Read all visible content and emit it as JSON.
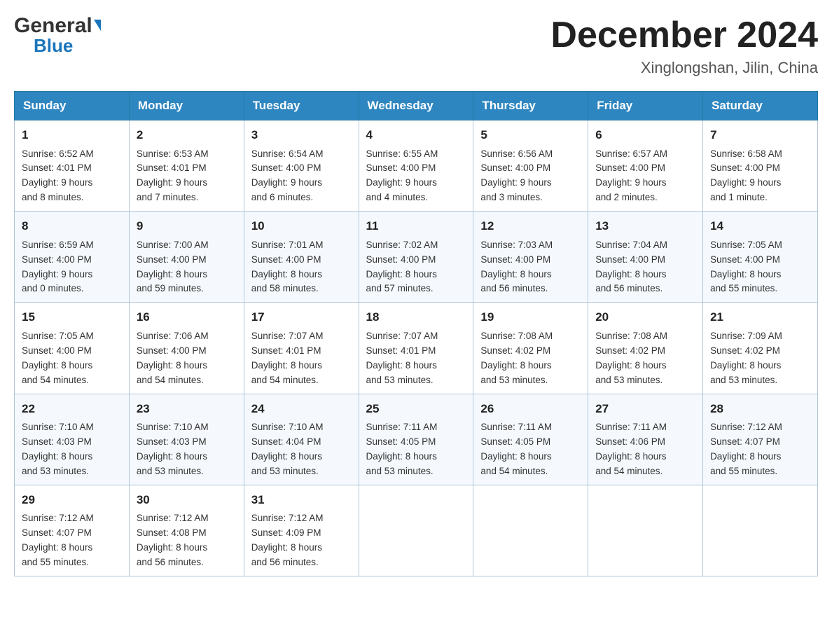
{
  "logo": {
    "general": "General",
    "blue": "Blue"
  },
  "title": "December 2024",
  "location": "Xinglongshan, Jilin, China",
  "days_of_week": [
    "Sunday",
    "Monday",
    "Tuesday",
    "Wednesday",
    "Thursday",
    "Friday",
    "Saturday"
  ],
  "weeks": [
    [
      {
        "day": "1",
        "info": "Sunrise: 6:52 AM\nSunset: 4:01 PM\nDaylight: 9 hours\nand 8 minutes."
      },
      {
        "day": "2",
        "info": "Sunrise: 6:53 AM\nSunset: 4:01 PM\nDaylight: 9 hours\nand 7 minutes."
      },
      {
        "day": "3",
        "info": "Sunrise: 6:54 AM\nSunset: 4:00 PM\nDaylight: 9 hours\nand 6 minutes."
      },
      {
        "day": "4",
        "info": "Sunrise: 6:55 AM\nSunset: 4:00 PM\nDaylight: 9 hours\nand 4 minutes."
      },
      {
        "day": "5",
        "info": "Sunrise: 6:56 AM\nSunset: 4:00 PM\nDaylight: 9 hours\nand 3 minutes."
      },
      {
        "day": "6",
        "info": "Sunrise: 6:57 AM\nSunset: 4:00 PM\nDaylight: 9 hours\nand 2 minutes."
      },
      {
        "day": "7",
        "info": "Sunrise: 6:58 AM\nSunset: 4:00 PM\nDaylight: 9 hours\nand 1 minute."
      }
    ],
    [
      {
        "day": "8",
        "info": "Sunrise: 6:59 AM\nSunset: 4:00 PM\nDaylight: 9 hours\nand 0 minutes."
      },
      {
        "day": "9",
        "info": "Sunrise: 7:00 AM\nSunset: 4:00 PM\nDaylight: 8 hours\nand 59 minutes."
      },
      {
        "day": "10",
        "info": "Sunrise: 7:01 AM\nSunset: 4:00 PM\nDaylight: 8 hours\nand 58 minutes."
      },
      {
        "day": "11",
        "info": "Sunrise: 7:02 AM\nSunset: 4:00 PM\nDaylight: 8 hours\nand 57 minutes."
      },
      {
        "day": "12",
        "info": "Sunrise: 7:03 AM\nSunset: 4:00 PM\nDaylight: 8 hours\nand 56 minutes."
      },
      {
        "day": "13",
        "info": "Sunrise: 7:04 AM\nSunset: 4:00 PM\nDaylight: 8 hours\nand 56 minutes."
      },
      {
        "day": "14",
        "info": "Sunrise: 7:05 AM\nSunset: 4:00 PM\nDaylight: 8 hours\nand 55 minutes."
      }
    ],
    [
      {
        "day": "15",
        "info": "Sunrise: 7:05 AM\nSunset: 4:00 PM\nDaylight: 8 hours\nand 54 minutes."
      },
      {
        "day": "16",
        "info": "Sunrise: 7:06 AM\nSunset: 4:00 PM\nDaylight: 8 hours\nand 54 minutes."
      },
      {
        "day": "17",
        "info": "Sunrise: 7:07 AM\nSunset: 4:01 PM\nDaylight: 8 hours\nand 54 minutes."
      },
      {
        "day": "18",
        "info": "Sunrise: 7:07 AM\nSunset: 4:01 PM\nDaylight: 8 hours\nand 53 minutes."
      },
      {
        "day": "19",
        "info": "Sunrise: 7:08 AM\nSunset: 4:02 PM\nDaylight: 8 hours\nand 53 minutes."
      },
      {
        "day": "20",
        "info": "Sunrise: 7:08 AM\nSunset: 4:02 PM\nDaylight: 8 hours\nand 53 minutes."
      },
      {
        "day": "21",
        "info": "Sunrise: 7:09 AM\nSunset: 4:02 PM\nDaylight: 8 hours\nand 53 minutes."
      }
    ],
    [
      {
        "day": "22",
        "info": "Sunrise: 7:10 AM\nSunset: 4:03 PM\nDaylight: 8 hours\nand 53 minutes."
      },
      {
        "day": "23",
        "info": "Sunrise: 7:10 AM\nSunset: 4:03 PM\nDaylight: 8 hours\nand 53 minutes."
      },
      {
        "day": "24",
        "info": "Sunrise: 7:10 AM\nSunset: 4:04 PM\nDaylight: 8 hours\nand 53 minutes."
      },
      {
        "day": "25",
        "info": "Sunrise: 7:11 AM\nSunset: 4:05 PM\nDaylight: 8 hours\nand 53 minutes."
      },
      {
        "day": "26",
        "info": "Sunrise: 7:11 AM\nSunset: 4:05 PM\nDaylight: 8 hours\nand 54 minutes."
      },
      {
        "day": "27",
        "info": "Sunrise: 7:11 AM\nSunset: 4:06 PM\nDaylight: 8 hours\nand 54 minutes."
      },
      {
        "day": "28",
        "info": "Sunrise: 7:12 AM\nSunset: 4:07 PM\nDaylight: 8 hours\nand 55 minutes."
      }
    ],
    [
      {
        "day": "29",
        "info": "Sunrise: 7:12 AM\nSunset: 4:07 PM\nDaylight: 8 hours\nand 55 minutes."
      },
      {
        "day": "30",
        "info": "Sunrise: 7:12 AM\nSunset: 4:08 PM\nDaylight: 8 hours\nand 56 minutes."
      },
      {
        "day": "31",
        "info": "Sunrise: 7:12 AM\nSunset: 4:09 PM\nDaylight: 8 hours\nand 56 minutes."
      },
      {
        "day": "",
        "info": ""
      },
      {
        "day": "",
        "info": ""
      },
      {
        "day": "",
        "info": ""
      },
      {
        "day": "",
        "info": ""
      }
    ]
  ]
}
